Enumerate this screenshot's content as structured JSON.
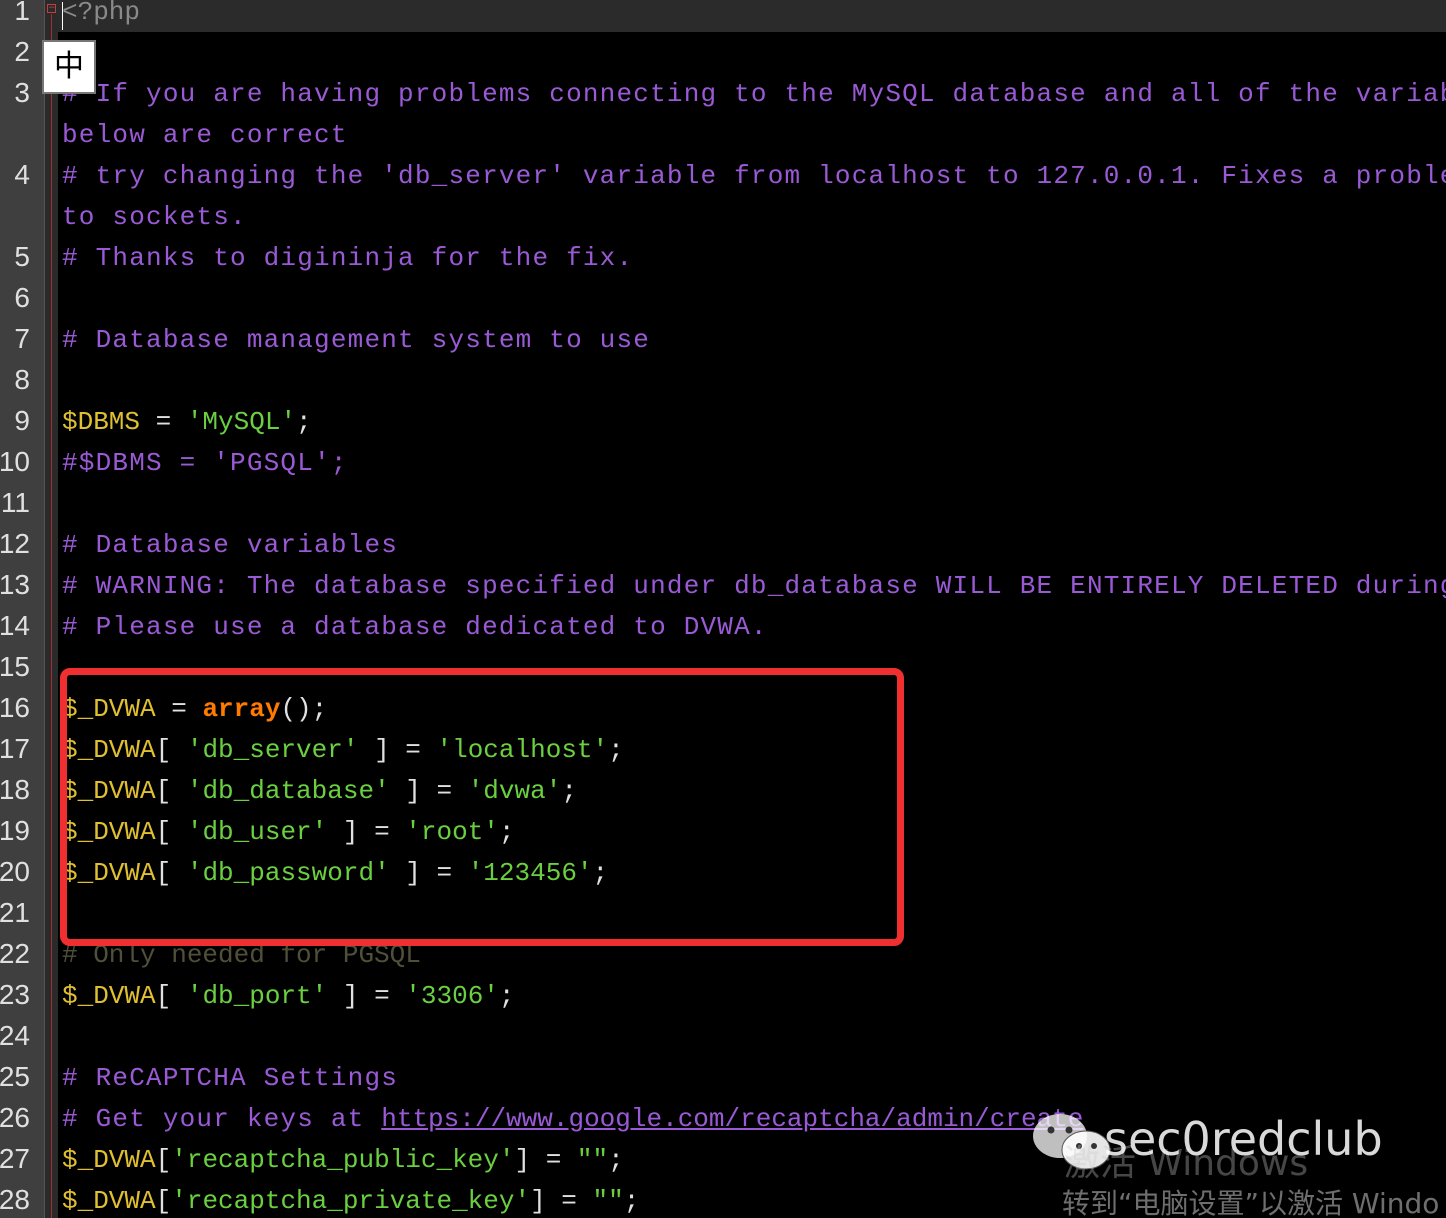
{
  "ime": {
    "indicator": "中"
  },
  "lines": [
    {
      "n": "1",
      "tokens": [
        {
          "t": "<?php",
          "c": "php-tag"
        }
      ]
    },
    {
      "n": "2",
      "tokens": []
    },
    {
      "n": "3",
      "tokens": [
        {
          "t": "# If you are having problems connecting to the MySQL database and all of the variables",
          "c": "comment"
        }
      ]
    },
    {
      "n": "",
      "tokens": [
        {
          "t": "below are correct",
          "c": "comment"
        }
      ]
    },
    {
      "n": "4",
      "tokens": [
        {
          "t": "# try changing the 'db_server' variable from localhost to 127.0.0.1. Fixes a problem du",
          "c": "comment"
        }
      ]
    },
    {
      "n": "",
      "tokens": [
        {
          "t": "to sockets.",
          "c": "comment"
        }
      ]
    },
    {
      "n": "5",
      "tokens": [
        {
          "t": "# Thanks to digininja for the fix.",
          "c": "comment"
        }
      ]
    },
    {
      "n": "6",
      "tokens": []
    },
    {
      "n": "7",
      "tokens": [
        {
          "t": "# Database management system to use",
          "c": "comment"
        }
      ]
    },
    {
      "n": "8",
      "tokens": []
    },
    {
      "n": "9",
      "tokens": [
        {
          "t": "$DBMS",
          "c": "var"
        },
        {
          "t": " = ",
          "c": "op"
        },
        {
          "t": "'MySQL'",
          "c": "str"
        },
        {
          "t": ";",
          "c": "op"
        }
      ]
    },
    {
      "n": "10",
      "tokens": [
        {
          "t": "#$DBMS = 'PGSQL';",
          "c": "comment"
        }
      ]
    },
    {
      "n": "11",
      "tokens": []
    },
    {
      "n": "12",
      "tokens": [
        {
          "t": "# Database variables",
          "c": "comment"
        }
      ]
    },
    {
      "n": "13",
      "tokens": [
        {
          "t": "# WARNING: The database specified under db_database WILL BE ENTIRELY DELETED during set",
          "c": "comment"
        }
      ]
    },
    {
      "n": "14",
      "tokens": [
        {
          "t": "# Please use a database dedicated to DVWA.",
          "c": "comment"
        }
      ]
    },
    {
      "n": "15",
      "tokens": []
    },
    {
      "n": "16",
      "tokens": [
        {
          "t": "$_DVWA",
          "c": "var"
        },
        {
          "t": " = ",
          "c": "op"
        },
        {
          "t": "array",
          "c": "kw"
        },
        {
          "t": "();",
          "c": "op"
        }
      ]
    },
    {
      "n": "17",
      "tokens": [
        {
          "t": "$_DVWA",
          "c": "var"
        },
        {
          "t": "[ ",
          "c": "op"
        },
        {
          "t": "'db_server'",
          "c": "str"
        },
        {
          "t": " ] = ",
          "c": "op"
        },
        {
          "t": "'localhost'",
          "c": "str"
        },
        {
          "t": ";",
          "c": "op"
        }
      ]
    },
    {
      "n": "18",
      "tokens": [
        {
          "t": "$_DVWA",
          "c": "var"
        },
        {
          "t": "[ ",
          "c": "op"
        },
        {
          "t": "'db_database'",
          "c": "str"
        },
        {
          "t": " ] = ",
          "c": "op"
        },
        {
          "t": "'dvwa'",
          "c": "str"
        },
        {
          "t": ";",
          "c": "op"
        }
      ]
    },
    {
      "n": "19",
      "tokens": [
        {
          "t": "$_DVWA",
          "c": "var"
        },
        {
          "t": "[ ",
          "c": "op"
        },
        {
          "t": "'db_user'",
          "c": "str"
        },
        {
          "t": " ] = ",
          "c": "op"
        },
        {
          "t": "'root'",
          "c": "str"
        },
        {
          "t": ";",
          "c": "op"
        }
      ]
    },
    {
      "n": "20",
      "tokens": [
        {
          "t": "$_DVWA",
          "c": "var"
        },
        {
          "t": "[ ",
          "c": "op"
        },
        {
          "t": "'db_password'",
          "c": "str"
        },
        {
          "t": " ] = ",
          "c": "op"
        },
        {
          "t": "'123456'",
          "c": "str"
        },
        {
          "t": ";",
          "c": "op"
        }
      ]
    },
    {
      "n": "21",
      "tokens": []
    },
    {
      "n": "22",
      "tokens": [
        {
          "t": "# Only needed for PGSQL",
          "c": "dim"
        }
      ]
    },
    {
      "n": "23",
      "tokens": [
        {
          "t": "$_DVWA",
          "c": "var"
        },
        {
          "t": "[ ",
          "c": "op"
        },
        {
          "t": "'db_port'",
          "c": "str"
        },
        {
          "t": " ] = ",
          "c": "op"
        },
        {
          "t": "'3306'",
          "c": "str"
        },
        {
          "t": ";",
          "c": "op"
        }
      ]
    },
    {
      "n": "24",
      "tokens": []
    },
    {
      "n": "25",
      "tokens": [
        {
          "t": "# ReCAPTCHA Settings",
          "c": "comment"
        }
      ]
    },
    {
      "n": "26",
      "tokens": [
        {
          "t": "# Get your keys at ",
          "c": "comment"
        },
        {
          "t": "https://www.google.com/recaptcha/admin/create",
          "c": "link"
        }
      ]
    },
    {
      "n": "27",
      "tokens": [
        {
          "t": "$_DVWA",
          "c": "var"
        },
        {
          "t": "[",
          "c": "op"
        },
        {
          "t": "'recaptcha_public_key'",
          "c": "str"
        },
        {
          "t": "] = ",
          "c": "op"
        },
        {
          "t": "\"\"",
          "c": "str"
        },
        {
          "t": ";",
          "c": "op"
        }
      ]
    },
    {
      "n": "28",
      "tokens": [
        {
          "t": "$_DVWA",
          "c": "var"
        },
        {
          "t": "[",
          "c": "op"
        },
        {
          "t": "'recaptcha_private_key'",
          "c": "str"
        },
        {
          "t": "] = ",
          "c": "op"
        },
        {
          "t": "\"\"",
          "c": "str"
        },
        {
          "t": ";",
          "c": "op"
        }
      ]
    }
  ],
  "watermark": {
    "brand": "sec0redclub",
    "activate_title": "激活 Windows",
    "activate_sub": "转到“电脑设置”以激活 Windo"
  }
}
